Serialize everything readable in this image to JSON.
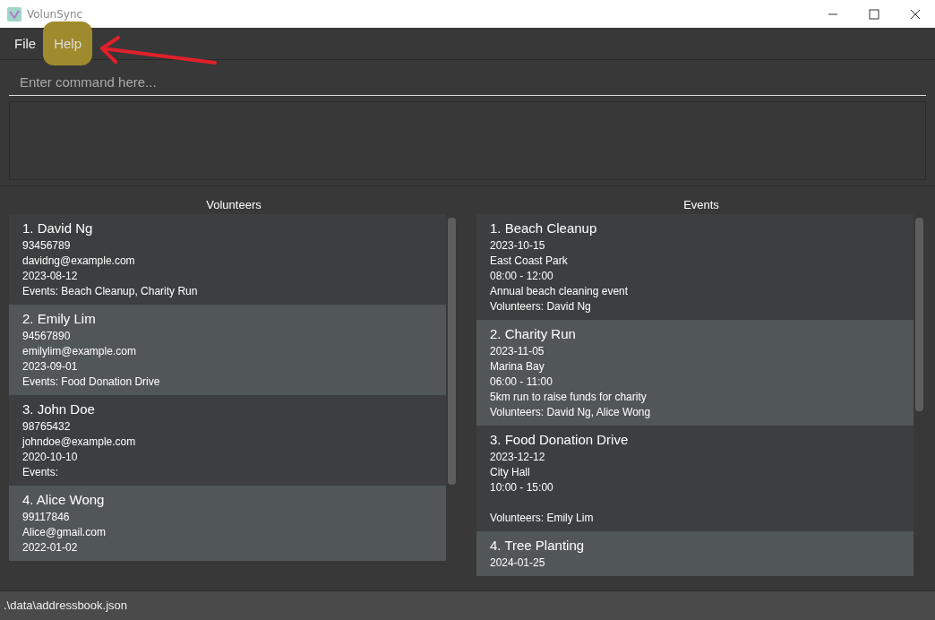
{
  "window": {
    "title": "VolunSync"
  },
  "menu": [
    {
      "label": "File",
      "highlighted": false
    },
    {
      "label": "Help",
      "highlighted": true
    }
  ],
  "command_box": {
    "placeholder": "Enter command here..."
  },
  "volunteers": {
    "heading": "Volunteers",
    "items": [
      {
        "title": "1. David Ng",
        "phone": "93456789",
        "email": "davidng@example.com",
        "date": "2023-08-12",
        "events": "Events: Beach Cleanup, Charity Run"
      },
      {
        "title": "2. Emily Lim",
        "phone": "94567890",
        "email": "emilylim@example.com",
        "date": "2023-09-01",
        "events": "Events: Food Donation Drive"
      },
      {
        "title": "3. John Doe",
        "phone": "98765432",
        "email": "johndoe@example.com",
        "date": "2020-10-10",
        "events": "Events:"
      },
      {
        "title": "4. Alice Wong",
        "phone": "99117846",
        "email": "Alice@gmail.com",
        "date": "2022-01-02"
      }
    ]
  },
  "events": {
    "heading": "Events",
    "items": [
      {
        "title": "1. Beach Cleanup",
        "date": "2023-10-15",
        "location": "East Coast Park",
        "time": "08:00 - 12:00",
        "description": "Annual beach cleaning event",
        "volunteers": "Volunteers: David Ng"
      },
      {
        "title": "2. Charity Run",
        "date": "2023-11-05",
        "location": "Marina Bay",
        "time": "06:00 - 11:00",
        "description": "5km run to raise funds for charity",
        "volunteers": "Volunteers: David Ng, Alice Wong"
      },
      {
        "title": "3. Food Donation Drive",
        "date": "2023-12-12",
        "location": "City Hall",
        "time": "10:00 - 15:00",
        "volunteers": "Volunteers: Emily Lim"
      },
      {
        "title": "4. Tree Planting",
        "date": "2024-01-25"
      }
    ]
  },
  "status_bar": {
    "path": ".\\data\\addressbook.json"
  }
}
